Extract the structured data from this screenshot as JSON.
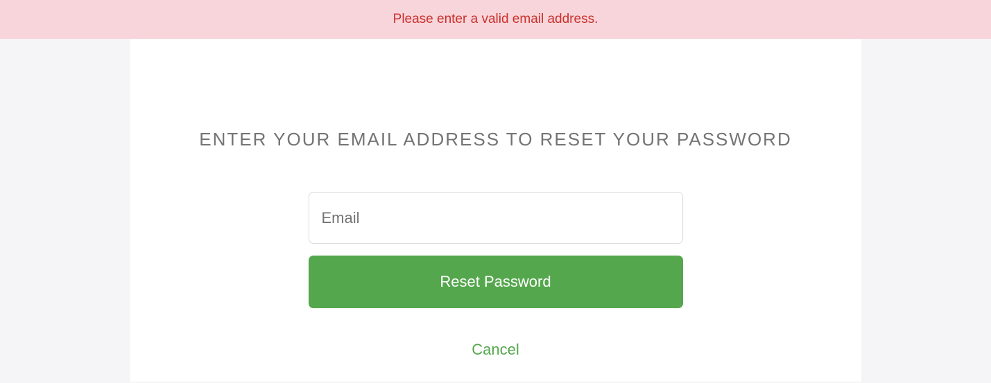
{
  "error": {
    "message": "Please enter a valid email address."
  },
  "form": {
    "heading": "ENTER YOUR EMAIL ADDRESS TO RESET YOUR PASSWORD",
    "email_placeholder": "Email",
    "email_value": "",
    "submit_label": "Reset Password",
    "cancel_label": "Cancel"
  }
}
